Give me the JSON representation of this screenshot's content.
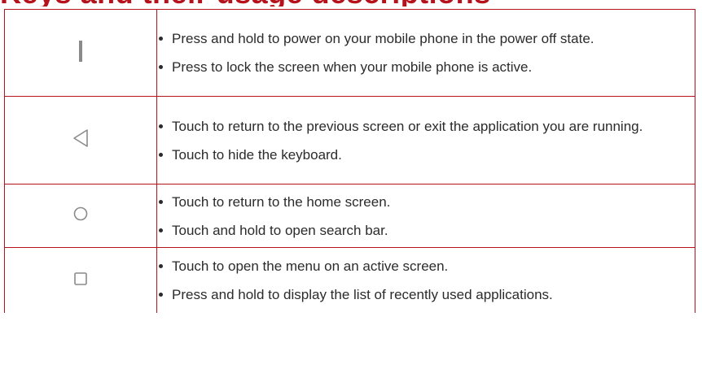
{
  "heading": "Keys and their usage descriptions",
  "rows": [
    {
      "icon": "power-key-icon",
      "items": [
        "Press and hold to power on your mobile phone in the power off state.",
        "Press to lock the screen when your mobile phone is active."
      ]
    },
    {
      "icon": "back-key-icon",
      "items": [
        "Touch to return to the previous screen or exit the application you are running.",
        "Touch to hide the keyboard."
      ]
    },
    {
      "icon": "home-key-icon",
      "items": [
        "Touch to return to the home screen.",
        "Touch and hold to open search bar."
      ]
    },
    {
      "icon": "menu-key-icon",
      "items": [
        "Touch to open the menu on an active screen.",
        "Press and hold to display the list of recently used applications."
      ]
    }
  ],
  "colors": {
    "heading": "#b5121b",
    "border": "#b5121b",
    "text": "#2b2b2b",
    "icon": "#8a8a8a"
  }
}
